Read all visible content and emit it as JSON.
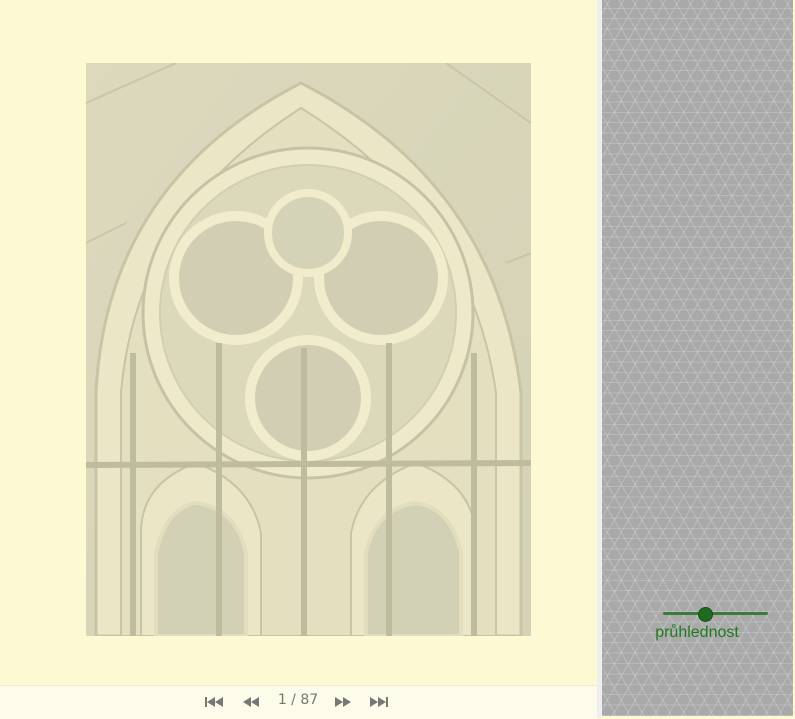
{
  "viewer": {
    "page_current": 1,
    "page_total": 87,
    "page_counter_text": "1 / 87",
    "icons": {
      "first": "skip-first-icon",
      "prev": "rewind-icon",
      "next": "fast-forward-icon",
      "last": "skip-last-icon"
    },
    "photo_subject": "gothic-tracery-window-photo"
  },
  "sidebar": {
    "opacity_label": "průhlednost",
    "opacity_value": 0.4
  },
  "colors": {
    "page_background": "#fdf9d3",
    "sidebar_background": "#a9a9a9",
    "accent_green": "#1f7a1f",
    "pager_icon": "#777777"
  }
}
